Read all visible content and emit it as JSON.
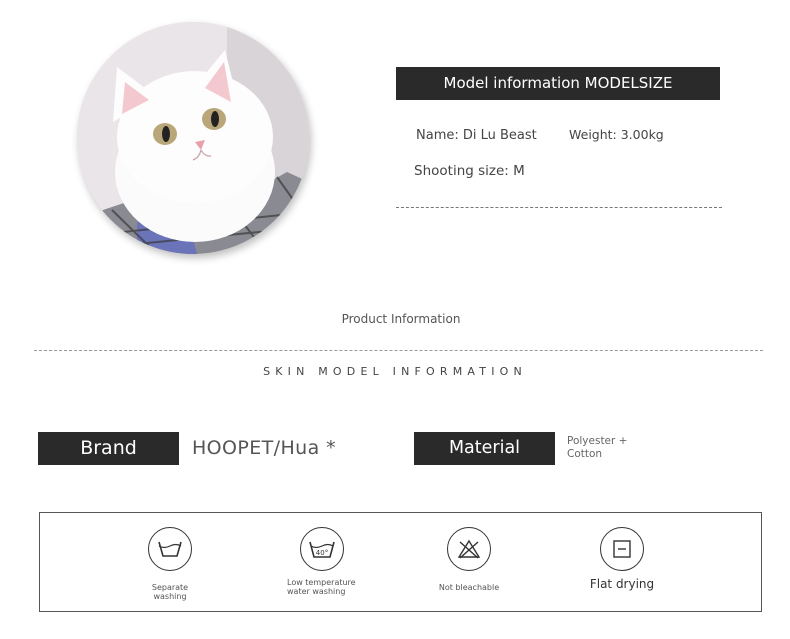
{
  "model_info": {
    "title": "Model information MODELSIZE",
    "name": "Name: Di Lu Beast",
    "weight": "Weight: 3.00kg",
    "shooting_size": "Shooting size: M"
  },
  "product_information": "Product Information",
  "skin_model_information": "SKIN MODEL INFORMATION",
  "brand": {
    "label": "Brand",
    "value": "HOOPET/Hua *"
  },
  "material": {
    "label": "Material",
    "value": "Polyester + Cotton"
  },
  "care": [
    {
      "label": "Separate washing",
      "icon": "separate-washing-icon"
    },
    {
      "label": "Low temperature water washing",
      "icon": "wash-40-icon",
      "temperature": "40°"
    },
    {
      "label": "Not bleachable",
      "icon": "no-bleach-icon"
    },
    {
      "label": "Flat drying",
      "icon": "flat-dry-icon"
    }
  ],
  "colors": {
    "dark_bar": "#2a2a2a",
    "text": "#444444"
  }
}
